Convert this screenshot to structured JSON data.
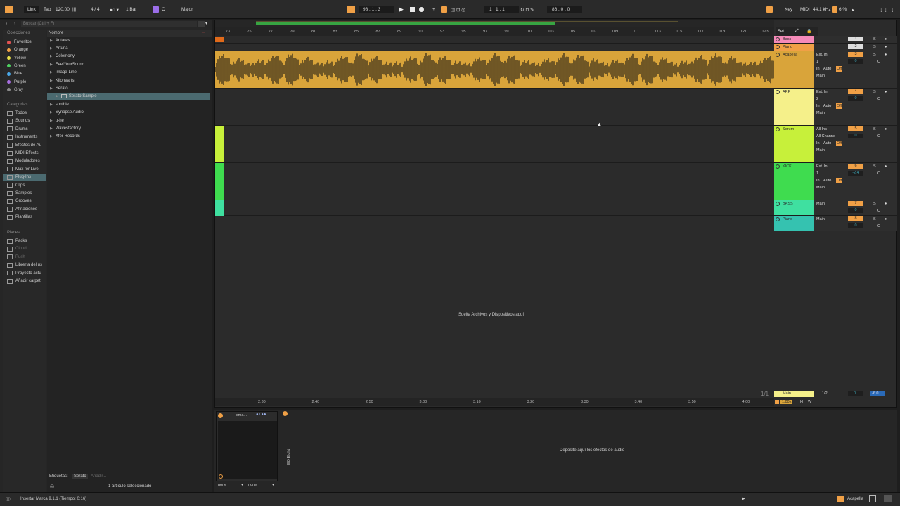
{
  "colors": {
    "accent": "#f0a046",
    "acapella": "#d9a43a",
    "arp": "#f5f08a",
    "serum": "#c7f03a",
    "kick": "#3fdc4f",
    "bass": "#3fe0a0",
    "piano_track": "#35c2b0",
    "bass_top": "#f58ab8",
    "piano_top": "#f0a046"
  },
  "topbar": {
    "link": "Link",
    "tap": "Tap",
    "tempo": "120.00",
    "signature": "4 / 4",
    "bar": "1 Bar",
    "key_root": "C",
    "scale": "Major",
    "position": "98 .  1 .  3",
    "loop_start": "1 .  1 .  1",
    "loop_length": "86 .  0 .  0",
    "key_btn": "Key",
    "midi_btn": "MIDI",
    "sample_rate": "44.1 kHz",
    "cpu": "6 %"
  },
  "browser": {
    "search_placeholder": "Buscar (Ctrl + F)",
    "collections_head": "Colecciones",
    "collections": [
      {
        "label": "Favoritos",
        "color": "#e35252"
      },
      {
        "label": "Orange",
        "color": "#f0a046"
      },
      {
        "label": "Yellow",
        "color": "#e8e04a"
      },
      {
        "label": "Green",
        "color": "#4ed060"
      },
      {
        "label": "Blue",
        "color": "#4aa8e8"
      },
      {
        "label": "Purple",
        "color": "#a76ee0"
      },
      {
        "label": "Gray",
        "color": "#8a8a8a"
      }
    ],
    "categories_head": "Categorías",
    "categories": [
      "Todos",
      "Sounds",
      "Drums",
      "Instruments",
      "Efectos de Au",
      "MIDI Effects",
      "Moduladores",
      "Max for Live",
      "Plug-Ins",
      "Clips",
      "Samples",
      "Grooves",
      "Afinaciones",
      "Plantillas"
    ],
    "places_head": "Places",
    "places": [
      "Packs",
      "Cloud",
      "Push",
      "Librería del us",
      "Proyecto actu",
      "Añadir carpet"
    ],
    "column_name": "Nombre",
    "files": [
      "Antares",
      "Arturia",
      "Celemony",
      "FeelYourSound",
      "Image-Line",
      "Kilohearts",
      "Serato",
      "Serato Sample",
      "sonible",
      "Synapse Audio",
      "u-he",
      "Wavesfactory",
      "Xfer Records"
    ],
    "tags_label": "Etiquetas:",
    "tag_serato": "Serato",
    "tag_add": "Añadir...",
    "selection_status": "1 artículo seleccionado"
  },
  "arrangement": {
    "bar_numbers": [
      "73",
      "75",
      "77",
      "79",
      "81",
      "83",
      "85",
      "87",
      "89",
      "91",
      "93",
      "95",
      "97",
      "99",
      "101",
      "103",
      "105",
      "107",
      "109",
      "111",
      "113",
      "115",
      "117",
      "119",
      "121",
      "123"
    ],
    "set_label": "Set",
    "drop_hint": "Suelta Archivos y Dispositivos aquí",
    "page_indicator": "1/1",
    "time_ticks": [
      "2:30",
      "2:40",
      "2:50",
      "3:00",
      "3:10",
      "3:20",
      "3:30",
      "3:40",
      "3:50",
      "4:00"
    ],
    "tracks": [
      {
        "name": "Bass",
        "input": "",
        "ch": "",
        "num": "1"
      },
      {
        "name": "Piano",
        "input": "",
        "ch": "",
        "num": "2"
      },
      {
        "name": "Acapella",
        "input": "Ext. In",
        "ch": "1",
        "num": "3",
        "vol": "0",
        "pan": "C",
        "route": "Main"
      },
      {
        "name": "ARP",
        "input": "Ext. In",
        "ch": "2",
        "num": "4",
        "vol": "0",
        "pan": "C",
        "route": "Main"
      },
      {
        "name": "Serum",
        "input": "All Ins",
        "ch": "All Channe",
        "num": "5",
        "vol": "0",
        "pan": "C",
        "route": "Main"
      },
      {
        "name": "KICK",
        "input": "Ext. In",
        "ch": "1",
        "num": "6",
        "vol": "-2.4",
        "pan": "C",
        "route": "Main"
      },
      {
        "name": "BASS",
        "input": "Main",
        "num": "7",
        "vol": "0",
        "pan": "C"
      },
      {
        "name": "Piano",
        "input": "Main",
        "num": "8",
        "vol": "0",
        "pan": "C"
      }
    ],
    "monitor_in": "In",
    "monitor_auto": "Auto",
    "monitor_off": "Off",
    "main_label": "Main",
    "main_ratio": "1/2",
    "main_vol": "0",
    "main_db": "-6.0",
    "zoom": "1.00x",
    "h": "H",
    "w": "W"
  },
  "detail": {
    "device_name": "sma...",
    "none1": "none",
    "none2": "none",
    "vertical_label": "EQ Eight",
    "drop_hint": "Deposite aquí los efectos de audio"
  },
  "status": {
    "message": "Insertar Marca 9.1.1 (Tiempo: 0:16)",
    "track": "Acapella"
  }
}
